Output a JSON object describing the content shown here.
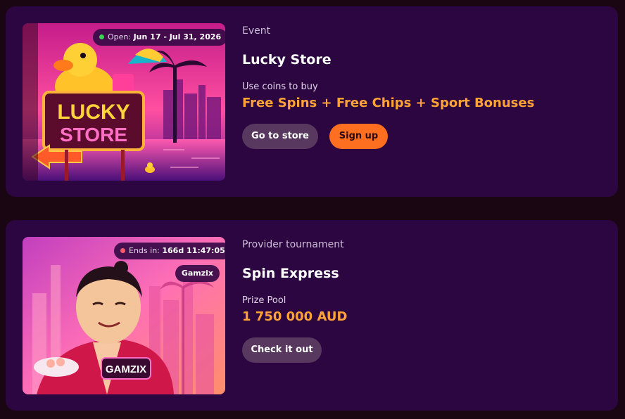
{
  "event_card": {
    "badge_label": "Open:",
    "badge_value": "Jun 17 - Jul 31, 2026",
    "badge_dot_color": "#39d353",
    "category": "Event",
    "title": "Lucky Store",
    "subtitle": "Use coins to buy",
    "highlight": "Free Spins + Free Chips + Sport Bonuses",
    "image_sign_line1": "LUCKY",
    "image_sign_line2": "STORE",
    "primary_button": "Go to store",
    "secondary_button": "Sign up"
  },
  "tournament_card": {
    "badge_label": "Ends in:",
    "badge_value": "166d 11:47:05",
    "badge_dot_color": "#ff5b6b",
    "provider_tag": "Gamzix",
    "image_logo": "GAMZIX",
    "category": "Provider tournament",
    "title": "Spin Express",
    "subtitle": "Prize Pool",
    "highlight": "1 750 000 AUD",
    "button": "Check it out"
  },
  "colors": {
    "background": "#1a0613",
    "card": "#2c0640",
    "accent_orange": "#ffa237",
    "button_orange": "#ff6f1f",
    "button_ghost": "#58385f"
  }
}
